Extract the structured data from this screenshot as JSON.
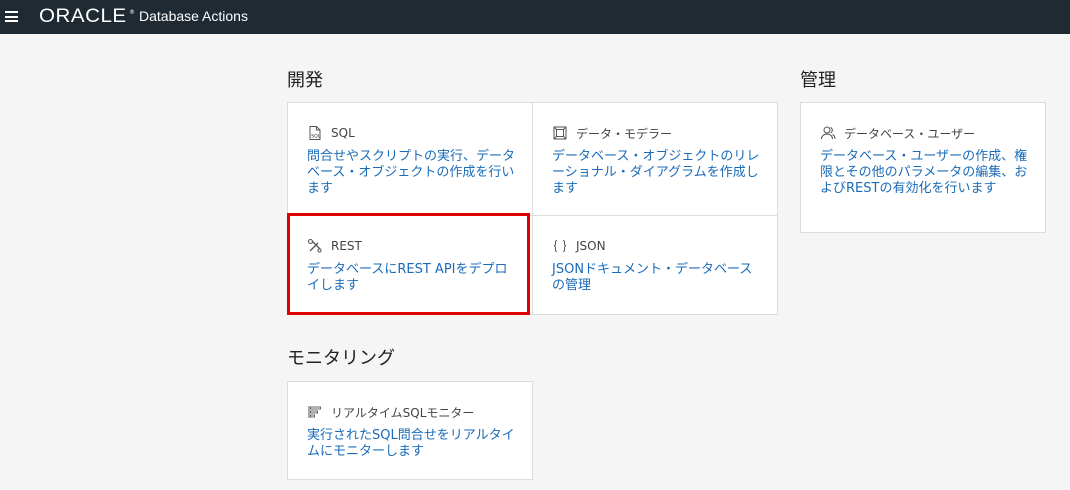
{
  "header": {
    "brand": "ORACLE",
    "brand_tm": "®",
    "app_title": "Database Actions"
  },
  "sections": {
    "develop": "開発",
    "admin": "管理",
    "monitoring": "モニタリング"
  },
  "cards": {
    "sql": {
      "label": "SQL",
      "desc": "問合せやスクリプトの実行、データベース・オブジェクトの作成を行います",
      "icon": "sql-file-icon"
    },
    "data_modeler": {
      "label": "データ・モデラー",
      "desc": "データベース・オブジェクトのリレーショナル・ダイアグラムを作成します",
      "icon": "data-modeler-icon"
    },
    "rest": {
      "label": "REST",
      "desc": "データベースにREST APIをデプロイします",
      "icon": "rest-tools-icon"
    },
    "json": {
      "label": "JSON",
      "desc": "JSONドキュメント・データベースの管理",
      "icon": "json-braces-icon"
    },
    "db_users": {
      "label": "データベース・ユーザー",
      "desc": "データベース・ユーザーの作成、権限とその他のパラメータの編集、およびRESTの有効化を行います",
      "icon": "users-icon"
    },
    "realtime_sql": {
      "label": "リアルタイムSQLモニター",
      "desc": "実行されたSQL問合せをリアルタイムにモニターします",
      "icon": "monitor-list-icon"
    }
  },
  "colors": {
    "topbar": "#1f2a33",
    "link": "#1a6bb8",
    "highlight": "#e00000",
    "background": "#f5f5f5"
  }
}
